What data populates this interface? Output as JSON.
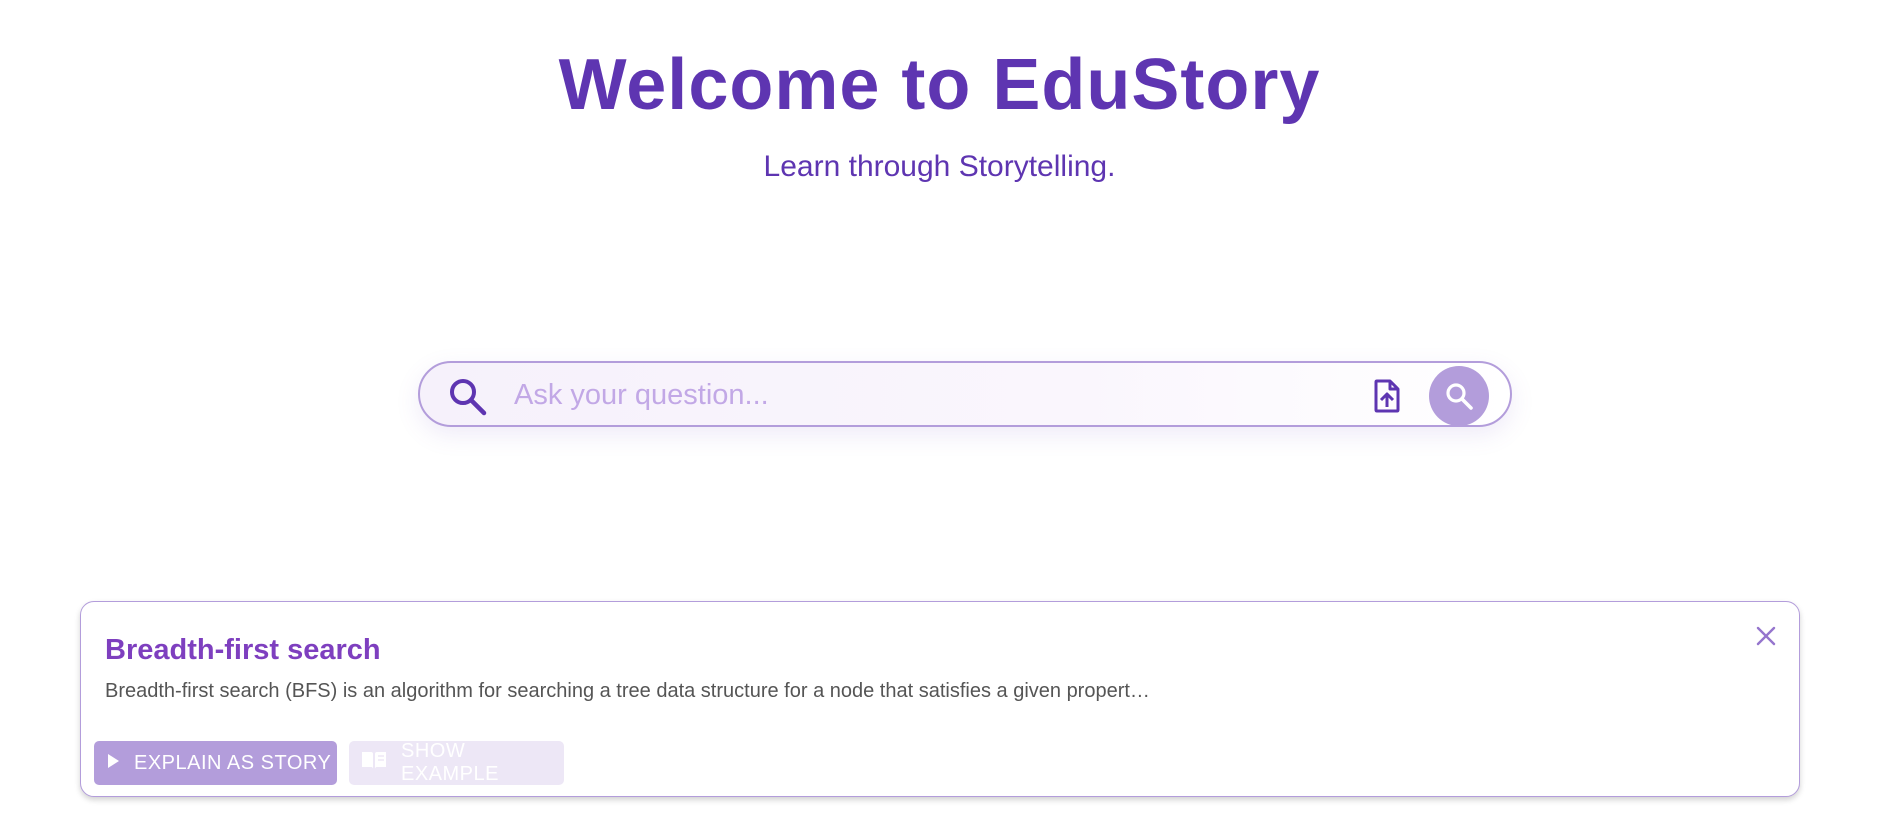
{
  "hero": {
    "title": "Welcome to EduStory",
    "subtitle": "Learn through Storytelling."
  },
  "search": {
    "placeholder": "Ask your question...",
    "value": "",
    "left_icon": "search-icon",
    "upload_icon": "file-upload-icon",
    "submit_icon": "search-icon"
  },
  "result": {
    "title": "Breadth-first search",
    "summary": "Breadth-first search (BFS) is an algorithm for searching a tree data structure for a node that satisfies a given propert…",
    "close_icon": "close-icon",
    "actions": {
      "explain_label": "EXPLAIN AS STORY",
      "explain_icon": "play-icon",
      "example_label": "SHOW EXAMPLE",
      "example_icon": "book-icon"
    }
  },
  "colors": {
    "brand": "#5e35b1",
    "accent": "#b39ddb",
    "accent_light": "#ede7f6",
    "card_title": "#7e3fbf",
    "body_text": "#555555"
  }
}
